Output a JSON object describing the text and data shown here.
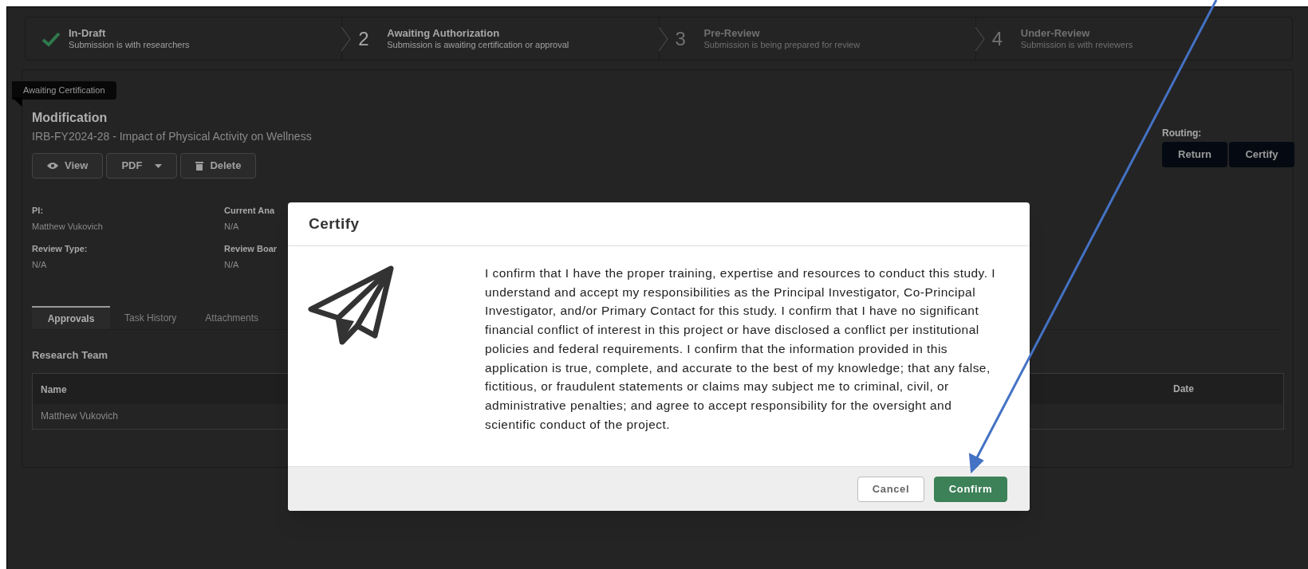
{
  "steps": [
    {
      "kind": "done",
      "title": "In-Draft",
      "subtitle": "Submission is with researchers"
    },
    {
      "kind": "current",
      "number": "2",
      "title": "Awaiting Authorization",
      "subtitle": "Submission is awaiting certification or approval"
    },
    {
      "kind": "upcoming",
      "number": "3",
      "title": "Pre-Review",
      "subtitle": "Submission is being prepared for review"
    },
    {
      "kind": "upcoming",
      "number": "4",
      "title": "Under-Review",
      "subtitle": "Submission is with reviewers"
    }
  ],
  "ribbon": "Awaiting Certification",
  "record": {
    "type": "Modification",
    "title": "IRB-FY2024-28 - Impact of Physical Activity on Wellness"
  },
  "actions": [
    {
      "kind": "view",
      "label": "View"
    },
    {
      "kind": "dropdown",
      "label": "PDF"
    },
    {
      "kind": "delete",
      "label": "Delete"
    }
  ],
  "routing": {
    "label": "Routing:",
    "buttons": [
      "Return",
      "Certify"
    ]
  },
  "fields": [
    {
      "label": "PI:",
      "value": "Matthew Vukovich"
    },
    {
      "label": "Current Ana",
      "value": "N/A"
    },
    {
      "label": "Review Type:",
      "value": "N/A"
    },
    {
      "label": "Review Boar",
      "value": "N/A"
    }
  ],
  "tabs": [
    {
      "label": "Approvals",
      "selected": true
    },
    {
      "label": "Task History",
      "selected": false
    },
    {
      "label": "Attachments",
      "selected": false
    }
  ],
  "section": {
    "title": "Research Team",
    "columns": [
      "Name",
      "Date"
    ],
    "rows": [
      {
        "name": "Matthew Vukovich"
      }
    ]
  },
  "modal": {
    "title": "Certify",
    "text": "I confirm that I have the proper training, expertise and resources to conduct this study. I understand and accept my responsibilities as the Principal Investigator, Co-Principal Investigator,  and/or Primary Contact for this study. I confirm that I have no significant financial conflict of interest in this project or have disclosed a conflict per institutional policies and federal requirements. I confirm that the information provided in this application is true, complete, and accurate to the best of my knowledge; that any false, fictitious, or fraudulent statements or claims may subject me to criminal, civil, or administrative penalties; and agree to accept responsibility for the oversight and scientific conduct of the project.",
    "buttons": [
      {
        "kind": "secondary",
        "label": "Cancel"
      },
      {
        "kind": "primary",
        "label": "Confirm"
      }
    ]
  }
}
